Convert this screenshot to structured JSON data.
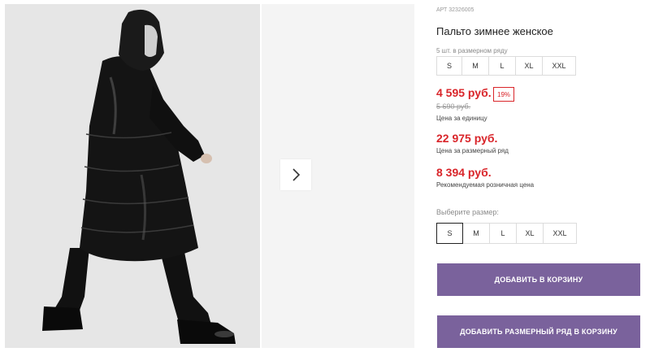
{
  "gallery": {
    "main_image_alt": "Пальто зимнее женское",
    "next_icon": "chevron-right-icon"
  },
  "product": {
    "art": "АРТ 32326005",
    "title": "Пальто зимнее женское",
    "row_label": "5 шт. в размерном ряду",
    "row_sizes": [
      "S",
      "M",
      "L",
      "XL",
      "XXL"
    ],
    "price": "4 595 руб.",
    "discount": "19%",
    "old_price": "5 690 руб.",
    "price_caption": "Цена за единицу",
    "row_price": "22 975 руб.",
    "row_price_caption": "Цена за размерный ряд",
    "rrp": "8 394 руб.",
    "rrp_caption": "Рекомендуемая розничная цена",
    "select_label": "Выберите размер:",
    "select_sizes": [
      "S",
      "M",
      "L",
      "XL",
      "XXL"
    ],
    "selected_size": "S",
    "add_to_cart": "ДОБАВИТЬ В КОРЗИНУ",
    "add_row_to_cart": "ДОБАВИТЬ РАЗМЕРНЫЙ РЯД В КОРЗИНУ"
  },
  "colors": {
    "price_red": "#d9252a",
    "button_purple": "#7a629c"
  }
}
